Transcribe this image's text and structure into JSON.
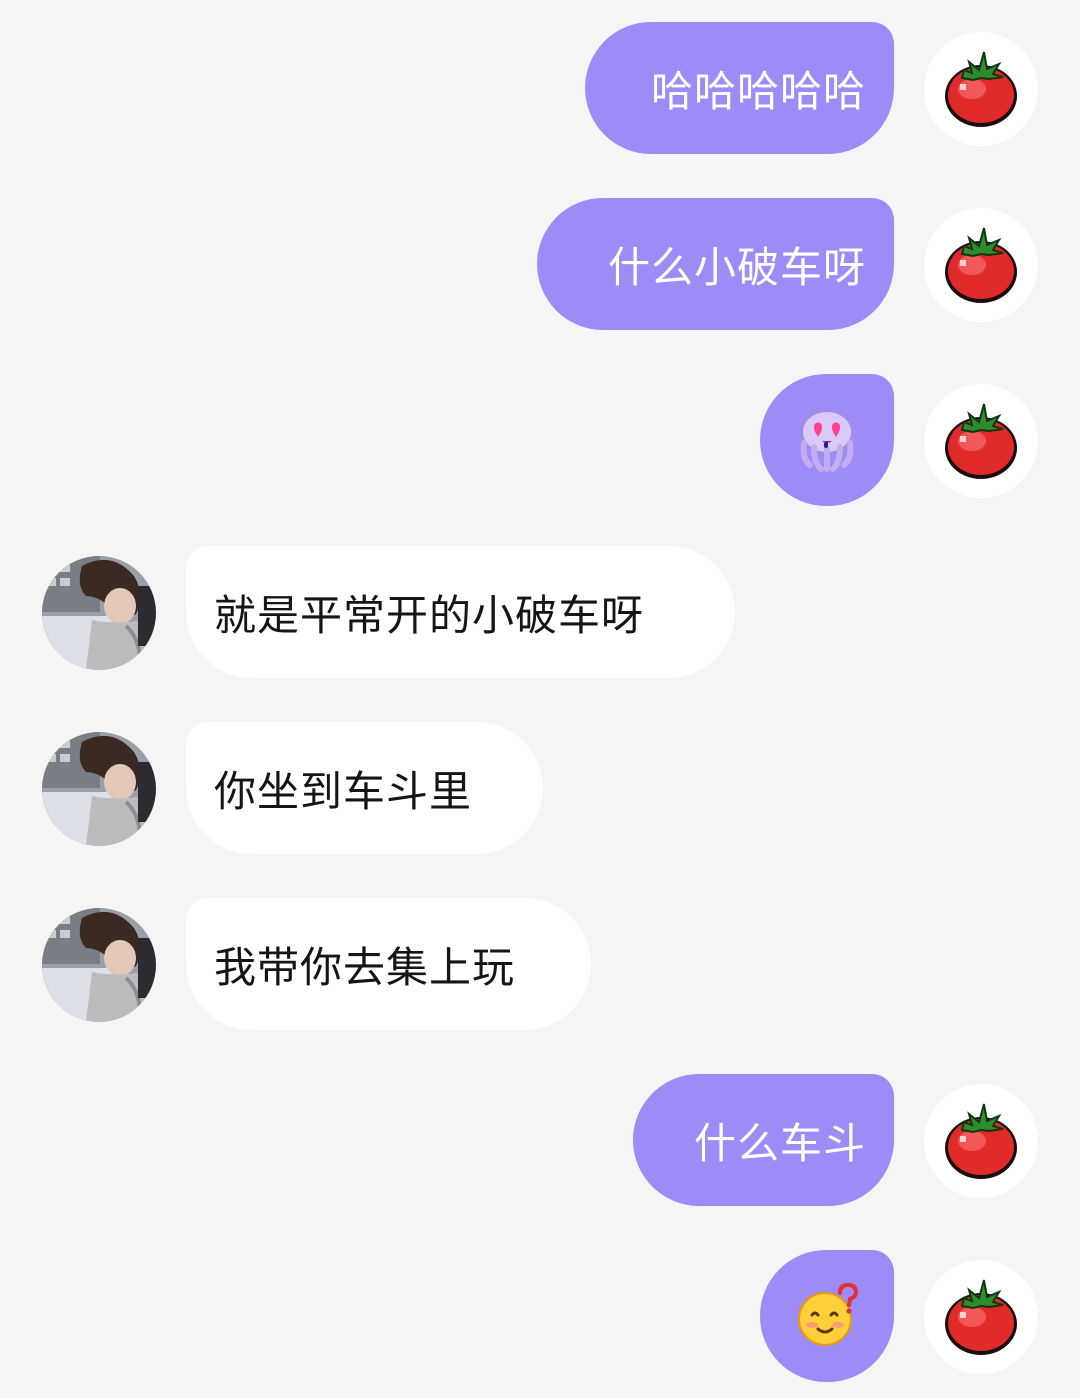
{
  "messages": [
    {
      "side": "out",
      "type": "text",
      "text": "哈哈哈哈哈"
    },
    {
      "side": "out",
      "type": "text",
      "text": "什么小破车呀"
    },
    {
      "side": "out",
      "type": "emoji",
      "emoji": "heart-eyes-octopus-sticker"
    },
    {
      "side": "in",
      "type": "text",
      "text": "就是平常开的小破车呀"
    },
    {
      "side": "in",
      "type": "text",
      "text": "你坐到车斗里"
    },
    {
      "side": "in",
      "type": "text",
      "text": "我带你去集上玩"
    },
    {
      "side": "out",
      "type": "text",
      "text": "什么车斗"
    },
    {
      "side": "out",
      "type": "emoji",
      "emoji": "confused-smiley-question-sticker"
    }
  ],
  "avatars": {
    "self": "tomato-avatar-icon",
    "other": "user-photo-avatar"
  },
  "colors": {
    "background": "#f5f5f5",
    "outgoing_bubble": "#9d8cf7",
    "outgoing_text": "#ffffff",
    "incoming_bubble": "#ffffff",
    "incoming_text": "#151515",
    "tomato_red": "#e12a2a",
    "tomato_leaf": "#2e8b2e"
  }
}
